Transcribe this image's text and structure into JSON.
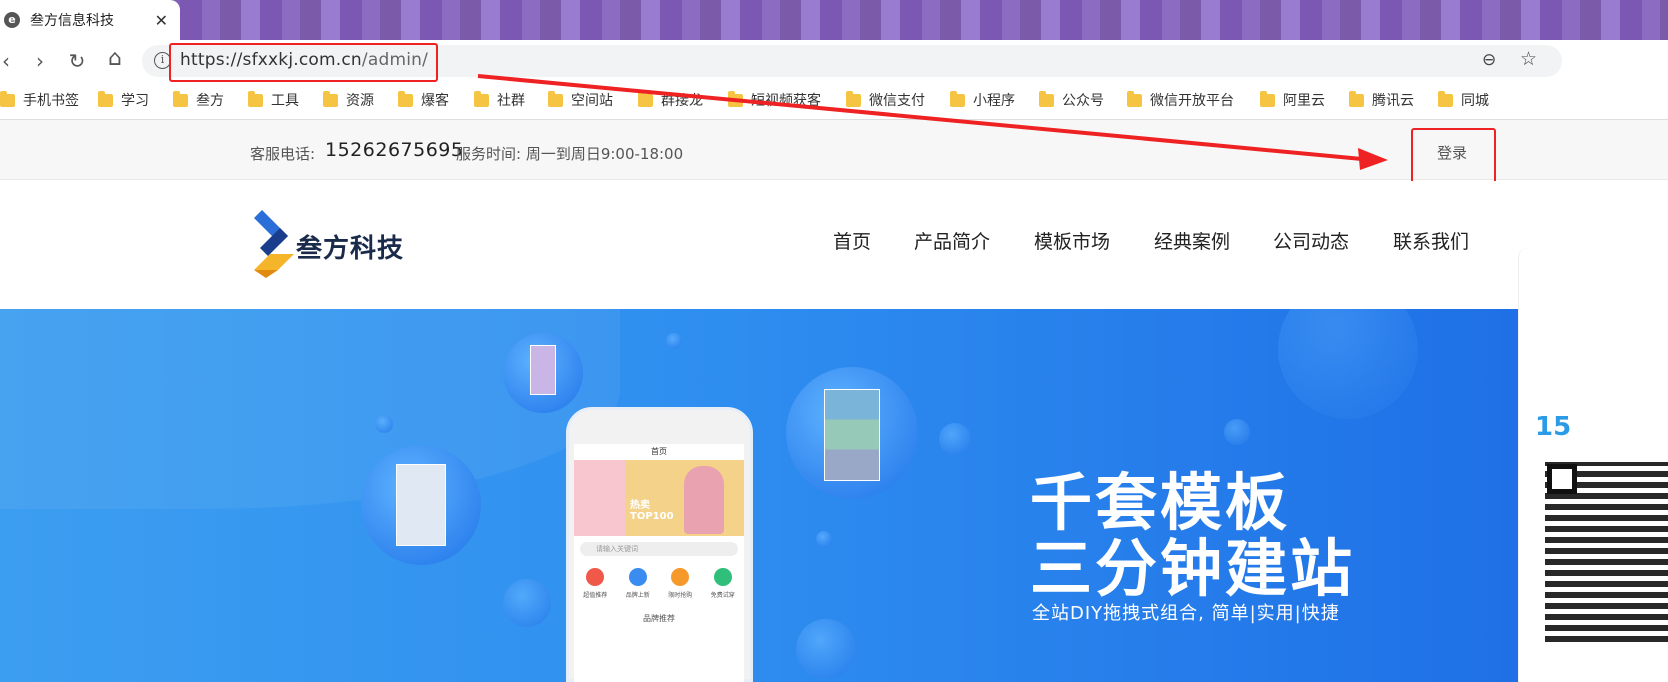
{
  "browser": {
    "tab_title": "叁方信息科技",
    "tab_close": "✕",
    "favicon": "e",
    "url_host": "https://sfxxkj.com.cn",
    "url_path": "/admin/",
    "nav": {
      "back": "‹",
      "forward": "›",
      "reload": "↻",
      "home": "⌂"
    },
    "zoom_icon": "⊖",
    "star_icon": "☆",
    "bookmarks": [
      "手机书签",
      "学习",
      "叁方",
      "工具",
      "资源",
      "爆客",
      "社群",
      "空间站",
      "群接龙",
      "短视频获客",
      "微信支付",
      "小程序",
      "公众号",
      "微信开放平台",
      "阿里云",
      "腾讯云",
      "同城"
    ]
  },
  "topbar": {
    "phone_label": "客服电话:",
    "phone_number": "15262675695",
    "service_time": "服务时间: 周一到周日9:00-18:00",
    "login": "登录"
  },
  "header": {
    "logo_text": "叁方科技",
    "menu": [
      "首页",
      "产品简介",
      "模板市场",
      "经典案例",
      "公司动态",
      "联系我们"
    ]
  },
  "hero": {
    "headline_1": "千套模板",
    "headline_2": "三分钟建站",
    "subline": "全站DIY拖拽式组合, 简单|实用|快捷",
    "phone_title": "首页",
    "phone_search": "请输入关键词",
    "phone_banner": "热卖 TOP100",
    "phone_icons": [
      "超值推荐",
      "品牌上新",
      "限时抢购",
      "免费试穿"
    ],
    "phone_section": "品牌推荐"
  },
  "side": {
    "number": "15"
  },
  "colors": {
    "accent": "#2f8ff0",
    "highlight": "#e22222",
    "tabstrip": "#8360b8"
  }
}
